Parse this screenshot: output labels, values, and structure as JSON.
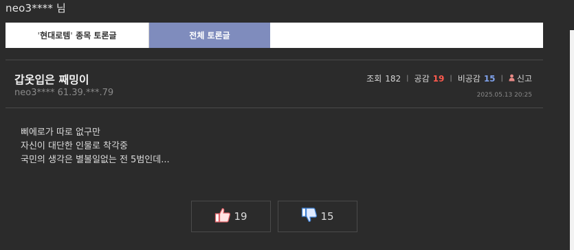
{
  "user": {
    "greeting": "neo3**** 님"
  },
  "tabs": {
    "stock_open_quote": "'",
    "stock_name": "현대로템",
    "stock_close_quote": "'",
    "stock_suffix": " 종목 토론글",
    "all": "전체 토론글"
  },
  "post": {
    "title": "갑옷입은 째밍이",
    "author": "neo3**** 61.39.***.79",
    "views_label": "조회",
    "views": "182",
    "agree_label": "공감",
    "agree": "19",
    "disagree_label": "비공감",
    "disagree": "15",
    "report_label": "신고",
    "date": "2025.05.13 20:25",
    "body": [
      "삐에로가 따로 없구만",
      "자신이 대단한 인물로 착각중",
      "국민의 생각은 별볼일없는 전 5범인데..."
    ]
  },
  "votes": {
    "up": "19",
    "down": "15"
  },
  "colors": {
    "tab_active": "#7f8cbd",
    "agree": "#ff5a4e",
    "disagree": "#7ea0e8"
  },
  "icons": {
    "report": "person-icon",
    "up": "thumbs-up-icon",
    "down": "thumbs-down-icon"
  }
}
